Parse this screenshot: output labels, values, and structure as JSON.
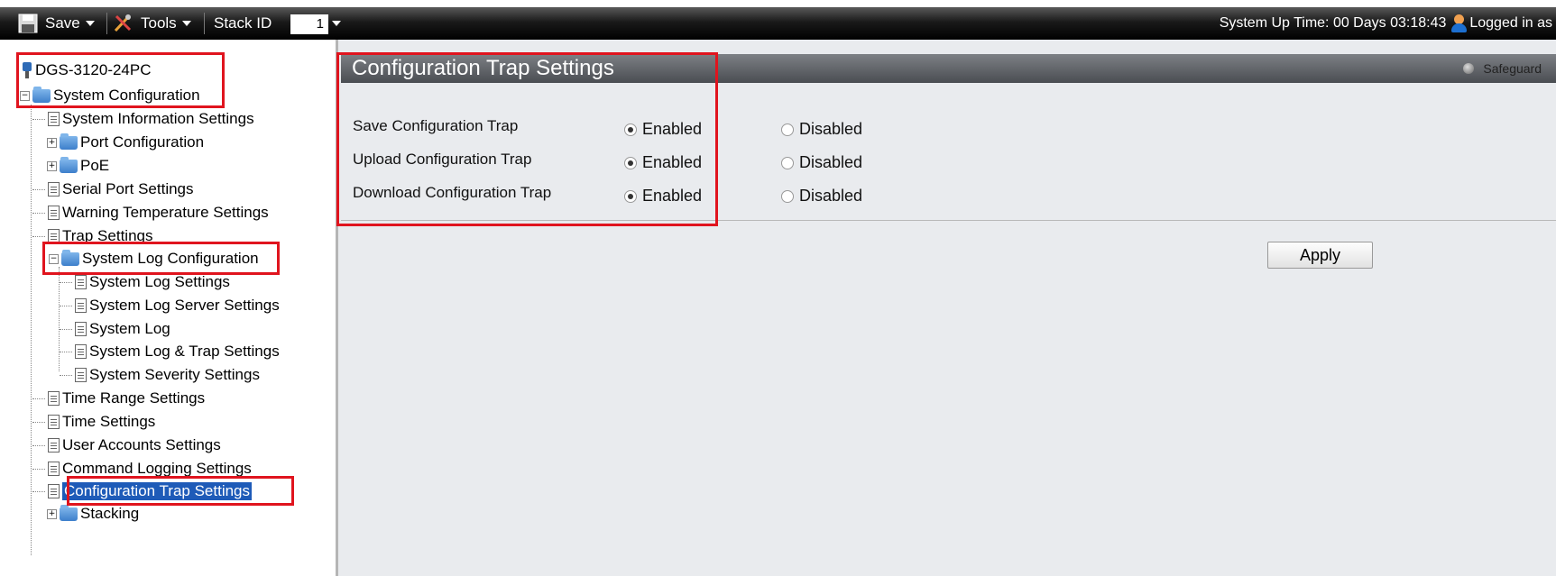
{
  "toolbar": {
    "save_label": "Save",
    "tools_label": "Tools",
    "stack_id_label": "Stack ID",
    "stack_id_value": "1",
    "uptime_text": "System Up Time: 00 Days 03:18:43",
    "logged_in_text": "Logged in as"
  },
  "tree": {
    "device": "DGS-3120-24PC",
    "system_configuration": "System Configuration",
    "items": [
      "System Information Settings",
      "Port Configuration",
      "PoE",
      "Serial Port Settings",
      "Warning Temperature Settings",
      "Trap Settings",
      "System Log Configuration",
      "System Log Settings",
      "System Log Server Settings",
      "System Log",
      "System Log & Trap Settings",
      "System Severity Settings",
      "Time Range Settings",
      "Time Settings",
      "User Accounts Settings",
      "Command Logging Settings",
      "Configuration Trap Settings",
      "Stacking"
    ]
  },
  "panel": {
    "title": "Configuration Trap Settings",
    "safeguard_label": "Safeguard",
    "enabled_label": "Enabled",
    "disabled_label": "Disabled",
    "rows": [
      {
        "label": "Save Configuration Trap",
        "value": "Enabled"
      },
      {
        "label": "Upload Configuration Trap",
        "value": "Enabled"
      },
      {
        "label": "Download Configuration Trap",
        "value": "Enabled"
      }
    ],
    "apply_label": "Apply"
  },
  "colors": {
    "highlight_box": "#e0141e",
    "selected_item": "#1e5bb8"
  }
}
